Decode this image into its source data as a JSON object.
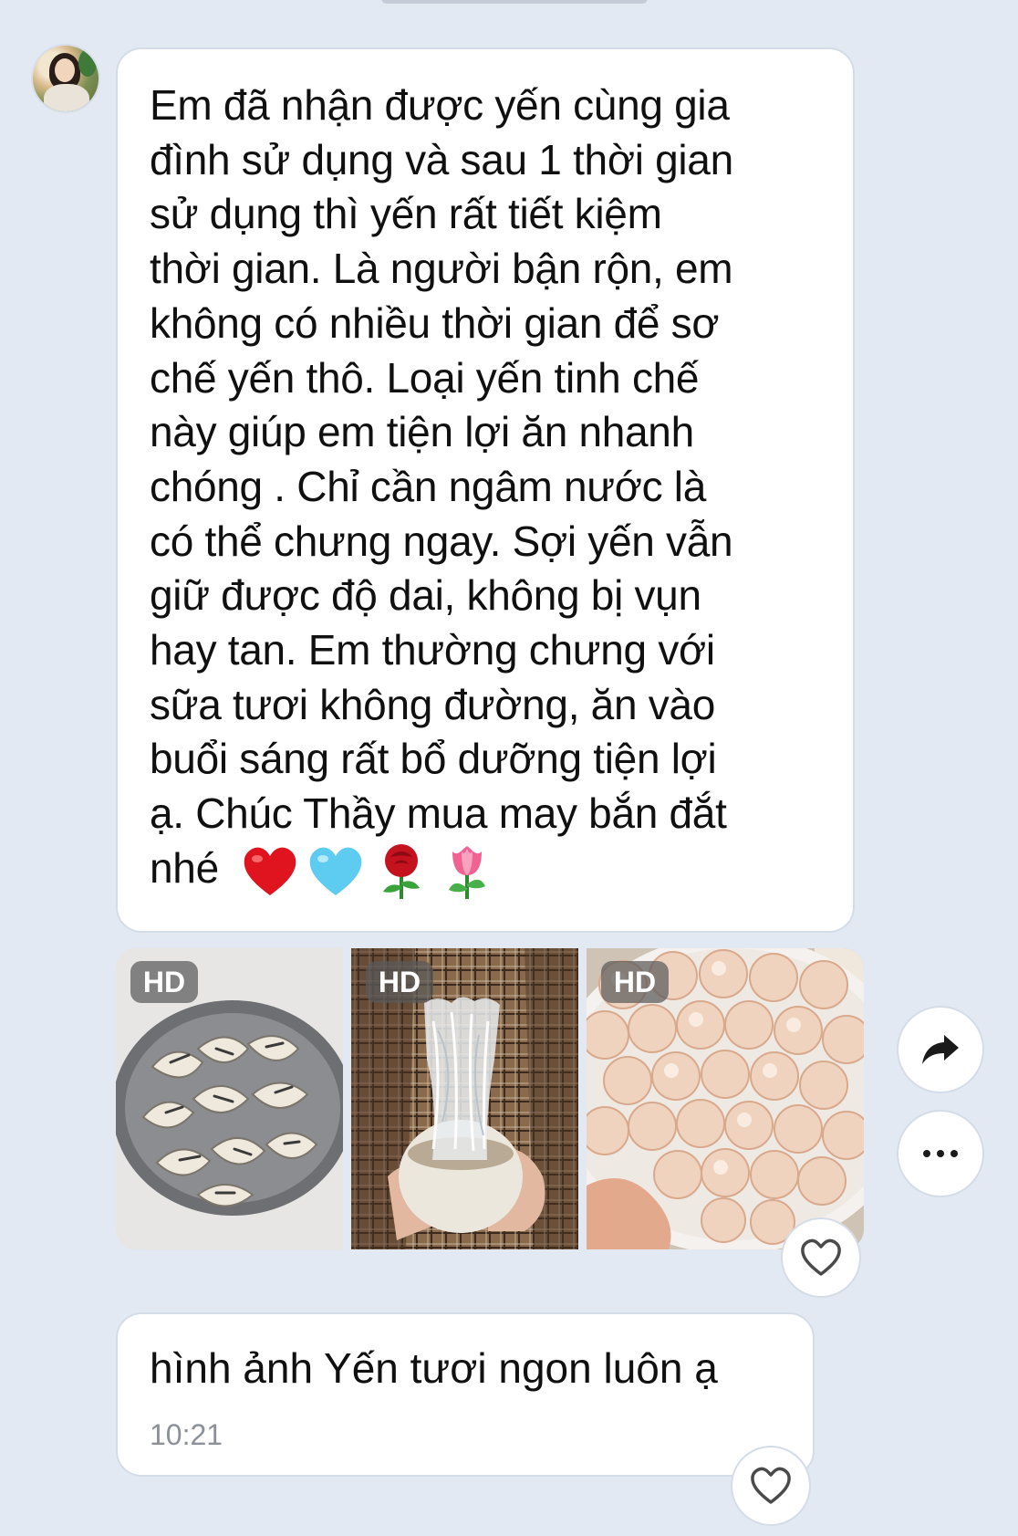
{
  "chat": {
    "message_1": {
      "text": "Em đã nhận được yến cùng gia\nđình sử dụng và sau 1 thời gian\nsử dụng thì yến rất tiết kiệm\nthời gian. Là người bận rộn, em\nkhông có nhiều thời gian để sơ\nchế yến thô. Loại yến tinh chế\nnày giúp em tiện lợi ăn nhanh\nchóng . Chỉ cần ngâm nước là\ncó thể chưng ngay. Sợi yến vẫn\ngiữ được độ dai, không bị vụn\nhay tan. Em thường chưng với\nsữa tươi không đường, ăn vào\nbuổi sáng rất bổ dưỡng tiện lợi\nạ. Chúc Thầy mua may bắn đắt\nnhé",
      "emojis": [
        "red-heart",
        "light-blue-heart",
        "rose",
        "tulip"
      ]
    },
    "photos": [
      {
        "badge": "HD",
        "subject": "raw-bird-nests-in-bowl"
      },
      {
        "badge": "HD",
        "subject": "steamed-bird-nest-in-coconut"
      },
      {
        "badge": "HD",
        "subject": "refined-bird-nest-cakes"
      }
    ],
    "message_2": {
      "text": "hình ảnh Yến tươi ngon luôn ạ",
      "time": "10:21"
    },
    "colors": {
      "background": "#e2e9f3",
      "bubble": "#ffffff",
      "timestamp": "#8b9099"
    }
  }
}
